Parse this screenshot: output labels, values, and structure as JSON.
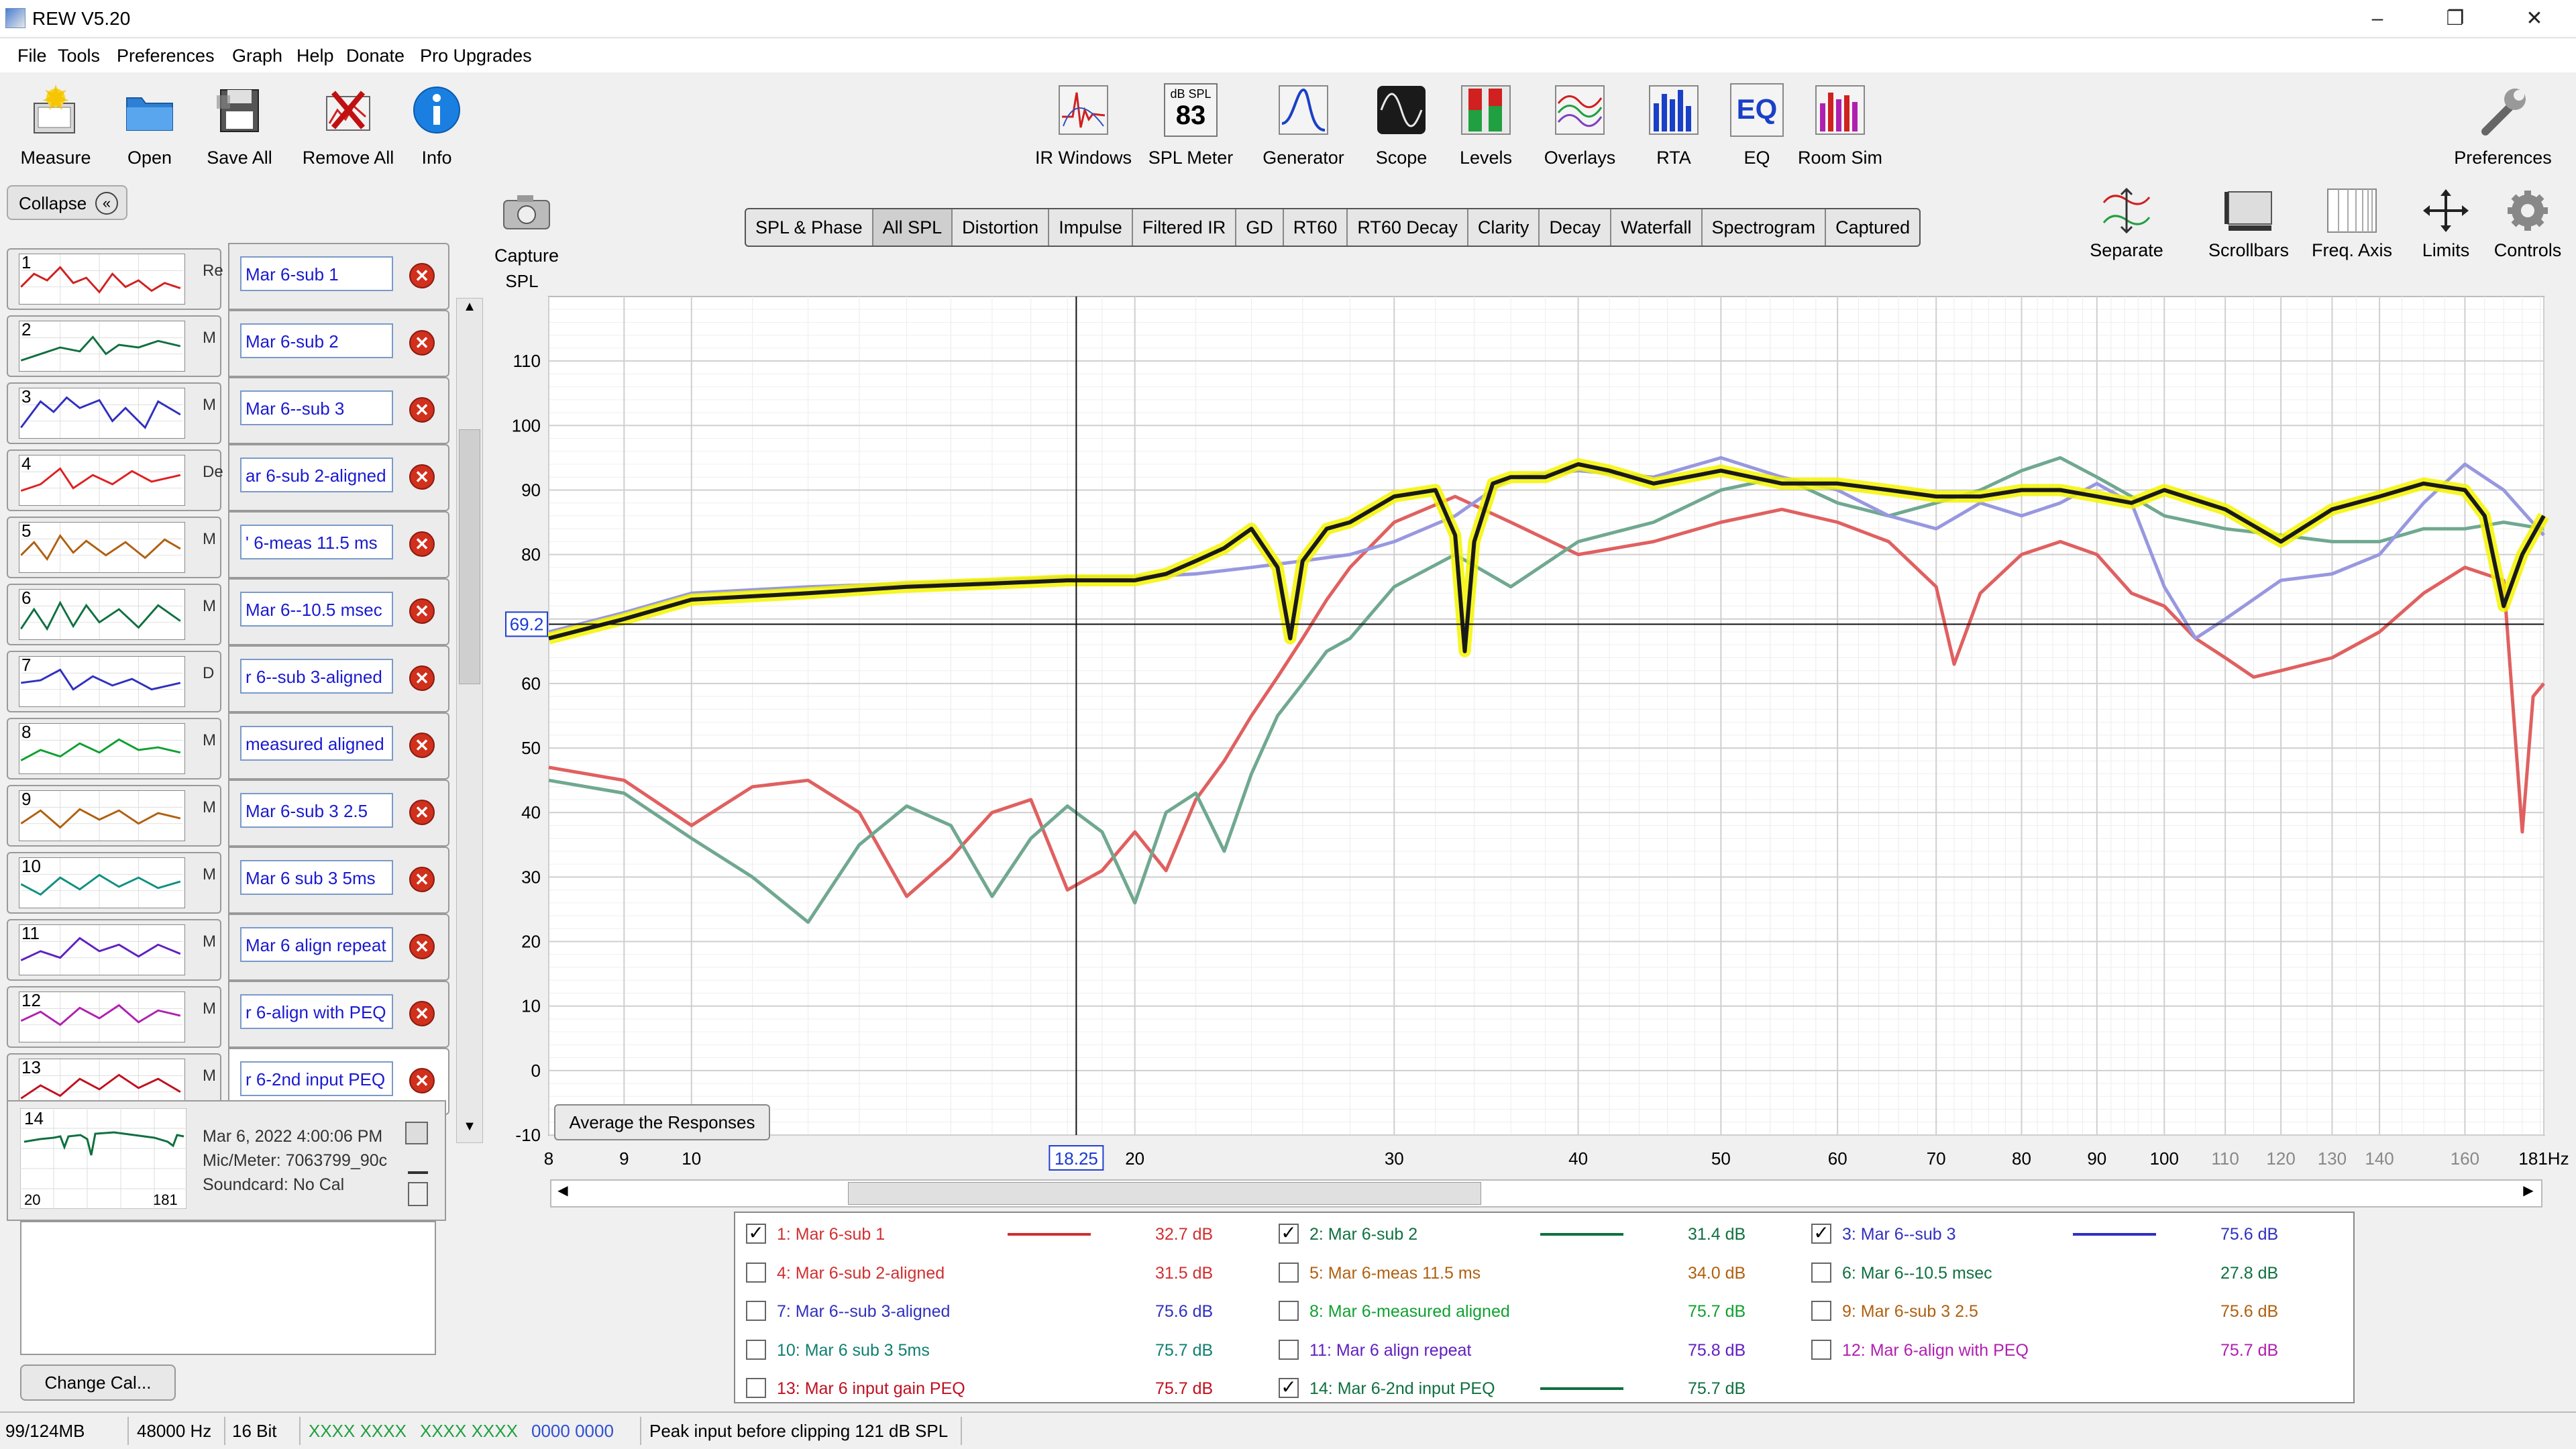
{
  "window": {
    "title": "REW V5.20",
    "minimize": "–",
    "restore": "❐",
    "close": "✕"
  },
  "menu": [
    "File",
    "Tools",
    "Preferences",
    "Graph",
    "Help",
    "Donate",
    "Pro Upgrades"
  ],
  "toolbar_left": [
    {
      "label": "Measure",
      "icon": "measure-icon"
    },
    {
      "label": "Open",
      "icon": "folder-icon"
    },
    {
      "label": "Save All",
      "icon": "save-icon"
    },
    {
      "label": "Remove All",
      "icon": "remove-icon"
    },
    {
      "label": "Info",
      "icon": "info-icon"
    }
  ],
  "toolbar_center": [
    {
      "label": "IR Windows",
      "icon": "ir-windows-icon"
    },
    {
      "label": "SPL Meter",
      "icon": "spl-meter-icon",
      "meter_unit": "dB SPL",
      "meter_value": "83"
    },
    {
      "label": "Generator",
      "icon": "generator-icon"
    },
    {
      "label": "Scope",
      "icon": "scope-icon"
    },
    {
      "label": "Levels",
      "icon": "levels-icon"
    },
    {
      "label": "Overlays",
      "icon": "overlays-icon"
    },
    {
      "label": "RTA",
      "icon": "rta-icon"
    },
    {
      "label": "EQ",
      "icon": "eq-icon"
    },
    {
      "label": "Room Sim",
      "icon": "room-sim-icon"
    }
  ],
  "preferences_label": "Preferences",
  "collapse_label": "Collapse",
  "measurements": [
    {
      "num": "1",
      "side": "Re",
      "name": "Mar 6-sub 1",
      "color": "#d02020"
    },
    {
      "num": "2",
      "side": "M",
      "name": "Mar 6-sub 2",
      "color": "#107040"
    },
    {
      "num": "3",
      "side": "M",
      "name": "Mar 6--sub 3",
      "color": "#3030c0"
    },
    {
      "num": "4",
      "side": "De",
      "name": "ar 6-sub 2-aligned",
      "color": "#e02020"
    },
    {
      "num": "5",
      "side": "M",
      "name": "' 6-meas 11.5 ms",
      "color": "#b06010"
    },
    {
      "num": "6",
      "side": "M",
      "name": "Mar 6--10.5 msec",
      "color": "#107040"
    },
    {
      "num": "7",
      "side": "D",
      "name": "r 6--sub 3-aligned",
      "color": "#3030c0"
    },
    {
      "num": "8",
      "side": "M",
      "name": "measured aligned",
      "color": "#10a030"
    },
    {
      "num": "9",
      "side": "M",
      "name": "Mar 6-sub 3 2.5",
      "color": "#b06010"
    },
    {
      "num": "10",
      "side": "M",
      "name": "Mar 6 sub 3 5ms",
      "color": "#109080"
    },
    {
      "num": "11",
      "side": "M",
      "name": "Mar 6 align repeat",
      "color": "#6020c0"
    },
    {
      "num": "12",
      "side": "M",
      "name": "r 6-align with PEQ",
      "color": "#b020b0"
    },
    {
      "num": "13",
      "side": "M",
      "name": "r 6 input gain PEQ",
      "color": "#c01020"
    }
  ],
  "selected_measurement": {
    "num": "14",
    "name": "r 6-2nd input PEQ",
    "date": "Mar 6, 2022 4:00:06 PM",
    "mic": "Mic/Meter: 7063799_90c",
    "soundcard": "Soundcard: No Cal",
    "thumb_left": "20",
    "thumb_right": "181"
  },
  "change_cal_label": "Change Cal...",
  "capture_label": "Capture",
  "graph_tabs": [
    "SPL & Phase",
    "All SPL",
    "Distortion",
    "Impulse",
    "Filtered IR",
    "GD",
    "RT60",
    "RT60 Decay",
    "Clarity",
    "Decay",
    "Waterfall",
    "Spectrogram",
    "Captured"
  ],
  "active_tab": "All SPL",
  "right_tools": [
    {
      "label": "Separate",
      "icon": "separate-icon"
    },
    {
      "label": "Scrollbars",
      "icon": "scrollbars-icon"
    },
    {
      "label": "Freq. Axis",
      "icon": "freq-axis-icon"
    },
    {
      "label": "Limits",
      "icon": "limits-icon"
    },
    {
      "label": "Controls",
      "icon": "controls-gear-icon"
    }
  ],
  "average_label": "Average the Responses",
  "cursor": {
    "x_readout": "18.25",
    "y_readout": "69.2"
  },
  "chart_data": {
    "type": "line",
    "ylabel": "SPL",
    "xscale": "log",
    "xlim": [
      8,
      181
    ],
    "ylim": [
      -10,
      120
    ],
    "yticks": [
      -10,
      0,
      10,
      20,
      30,
      40,
      50,
      60,
      70,
      80,
      90,
      100,
      110
    ],
    "xticks": [
      {
        "v": 8,
        "t": "8"
      },
      {
        "v": 9,
        "t": "9"
      },
      {
        "v": 10,
        "t": "10"
      },
      {
        "v": 20,
        "t": "20"
      },
      {
        "v": 30,
        "t": "30"
      },
      {
        "v": 40,
        "t": "40"
      },
      {
        "v": 50,
        "t": "50"
      },
      {
        "v": 60,
        "t": "60"
      },
      {
        "v": 70,
        "t": "70"
      },
      {
        "v": 80,
        "t": "80"
      },
      {
        "v": 90,
        "t": "90"
      },
      {
        "v": 100,
        "t": "100"
      },
      {
        "v": 110,
        "t": "110"
      },
      {
        "v": 120,
        "t": "120"
      },
      {
        "v": 130,
        "t": "130"
      },
      {
        "v": 140,
        "t": "140"
      },
      {
        "v": 160,
        "t": "160"
      },
      {
        "v": 181,
        "t": "181Hz"
      }
    ],
    "grid": true,
    "series": [
      {
        "name": "1: Mar 6-sub 1",
        "color": "#e06060",
        "x": [
          8,
          9,
          10,
          11,
          12,
          13,
          14,
          15,
          16,
          17,
          18,
          19,
          20,
          21,
          22,
          23,
          24,
          25,
          26,
          27,
          28,
          30,
          33,
          36,
          40,
          45,
          50,
          55,
          60,
          65,
          70,
          72,
          75,
          80,
          85,
          90,
          95,
          100,
          105,
          110,
          115,
          120,
          130,
          140,
          150,
          160,
          170,
          175,
          178,
          181
        ],
        "y": [
          47,
          45,
          38,
          44,
          45,
          40,
          27,
          33,
          40,
          42,
          28,
          31,
          37,
          31,
          42,
          48,
          55,
          61,
          67,
          73,
          78,
          85,
          89,
          85,
          80,
          82,
          85,
          87,
          85,
          82,
          75,
          63,
          74,
          80,
          82,
          80,
          74,
          72,
          67,
          64,
          61,
          62,
          64,
          68,
          74,
          78,
          76,
          37,
          58,
          60
        ]
      },
      {
        "name": "2: Mar 6-sub 2",
        "color": "#70a890",
        "x": [
          8,
          9,
          10,
          11,
          12,
          13,
          14,
          15,
          16,
          17,
          18,
          19,
          20,
          21,
          22,
          23,
          24,
          25,
          26,
          27,
          28,
          30,
          33,
          36,
          40,
          45,
          50,
          55,
          60,
          65,
          70,
          75,
          80,
          85,
          90,
          95,
          100,
          110,
          120,
          130,
          140,
          150,
          160,
          170,
          181
        ],
        "y": [
          45,
          43,
          36,
          30,
          23,
          35,
          41,
          38,
          27,
          36,
          41,
          37,
          26,
          40,
          43,
          34,
          46,
          55,
          60,
          65,
          67,
          75,
          80,
          75,
          82,
          85,
          90,
          92,
          88,
          86,
          88,
          90,
          93,
          95,
          92,
          89,
          86,
          84,
          83,
          82,
          82,
          84,
          84,
          85,
          84
        ]
      },
      {
        "name": "3: Mar 6--sub 3",
        "color": "#9898e0",
        "x": [
          8,
          9,
          10,
          12,
          14,
          16,
          18,
          20,
          22,
          24,
          26,
          28,
          30,
          33,
          36,
          40,
          45,
          50,
          55,
          60,
          65,
          70,
          75,
          80,
          85,
          90,
          95,
          100,
          105,
          110,
          120,
          130,
          140,
          150,
          160,
          170,
          181
        ],
        "y": [
          68,
          71,
          74,
          75,
          75.5,
          76,
          76.5,
          76.5,
          77,
          78,
          79,
          80,
          82,
          86,
          92,
          93,
          92,
          95,
          92,
          90,
          86,
          84,
          88,
          86,
          88,
          91,
          88,
          75,
          67,
          70,
          76,
          77,
          80,
          88,
          94,
          90,
          83
        ]
      },
      {
        "name": "14: Mar 6-2nd input PEQ",
        "color": "#1a1a1a",
        "x": [
          8,
          9,
          10,
          12,
          14,
          16,
          18,
          20,
          21,
          22,
          23,
          24,
          25,
          25.5,
          26,
          27,
          28,
          30,
          32,
          33,
          33.5,
          34,
          35,
          36,
          38,
          40,
          42,
          45,
          50,
          55,
          60,
          65,
          70,
          75,
          80,
          85,
          90,
          95,
          100,
          110,
          120,
          130,
          140,
          150,
          160,
          165,
          170,
          175,
          181
        ],
        "y": [
          67,
          70,
          73,
          74,
          75,
          75.5,
          76,
          76,
          77,
          79,
          81,
          84,
          78,
          67,
          79,
          84,
          85,
          89,
          90,
          83,
          65,
          82,
          91,
          92,
          92,
          94,
          93,
          91,
          93,
          91,
          91,
          90,
          89,
          89,
          90,
          90,
          89,
          88,
          90,
          87,
          82,
          87,
          89,
          91,
          90,
          86,
          72,
          80,
          86
        ]
      }
    ]
  },
  "legend": [
    {
      "checked": true,
      "name": "1: Mar 6-sub 1",
      "color": "#d03030",
      "line": "#d03030",
      "db": "32.7 dB"
    },
    {
      "checked": true,
      "name": "2: Mar 6-sub 2",
      "color": "#107040",
      "line": "#107040",
      "db": "31.4 dB"
    },
    {
      "checked": true,
      "name": "3: Mar 6--sub 3",
      "color": "#3030c0",
      "line": "#3030c0",
      "db": "75.6 dB"
    },
    {
      "checked": false,
      "name": "4: Mar 6-sub 2-aligned",
      "color": "#d03030",
      "line": "",
      "db": "31.5 dB"
    },
    {
      "checked": false,
      "name": "5: Mar 6-meas 11.5 ms",
      "color": "#b06010",
      "line": "",
      "db": "34.0 dB"
    },
    {
      "checked": false,
      "name": "6: Mar 6--10.5 msec",
      "color": "#107040",
      "line": "",
      "db": "27.8 dB"
    },
    {
      "checked": false,
      "name": "7: Mar 6--sub 3-aligned",
      "color": "#3030c0",
      "line": "",
      "db": "75.6 dB"
    },
    {
      "checked": false,
      "name": "8: Mar 6-measured aligned",
      "color": "#10a030",
      "line": "",
      "db": "75.7 dB"
    },
    {
      "checked": false,
      "name": "9: Mar 6-sub 3 2.5",
      "color": "#b06010",
      "line": "",
      "db": "75.6 dB"
    },
    {
      "checked": false,
      "name": "10: Mar 6 sub 3 5ms",
      "color": "#108070",
      "line": "",
      "db": "75.7 dB"
    },
    {
      "checked": false,
      "name": "11: Mar 6 align repeat",
      "color": "#6020c0",
      "line": "",
      "db": "75.8 dB"
    },
    {
      "checked": false,
      "name": "12: Mar 6-align with PEQ",
      "color": "#b020b0",
      "line": "",
      "db": "75.7 dB"
    },
    {
      "checked": false,
      "name": "13: Mar 6 input gain PEQ",
      "color": "#c01020",
      "line": "",
      "db": "75.7 dB"
    },
    {
      "checked": true,
      "name": "14: Mar 6-2nd input PEQ",
      "color": "#107040",
      "line": "#107040",
      "db": "75.7 dB"
    }
  ],
  "status": {
    "memory": "99/124MB",
    "rate": "48000 Hz",
    "bits": "16 Bit",
    "levels1": "XXXX XXXX",
    "levels2": "XXXX XXXX",
    "levels3": "0000 0000",
    "message": "Peak input before clipping 121 dB SPL"
  }
}
